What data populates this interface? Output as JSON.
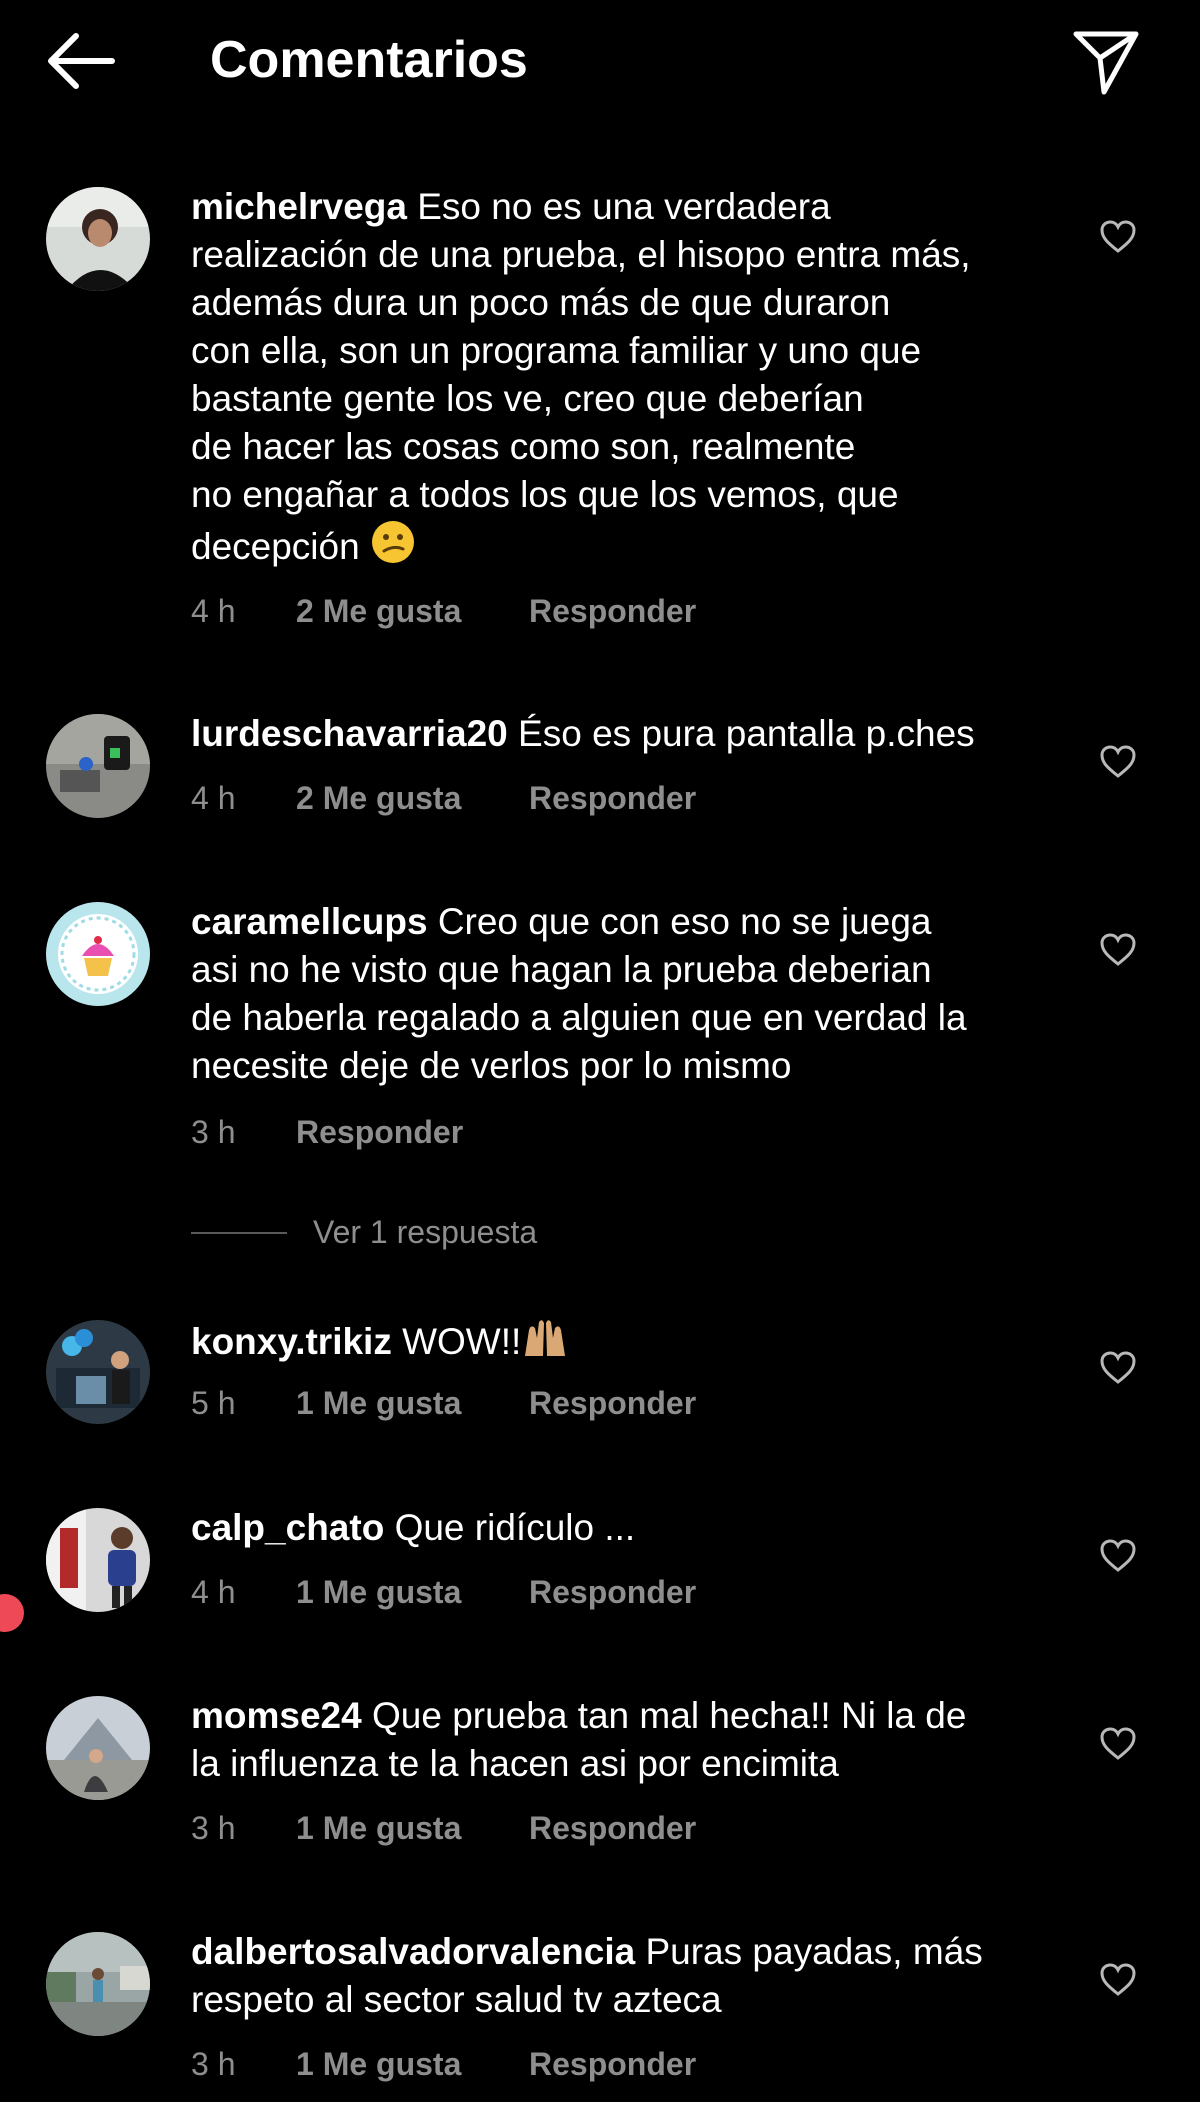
{
  "header": {
    "title": "Comentarios"
  },
  "comments": [
    {
      "username": "michelrvega",
      "text": "Eso no es una verdadera\nrealización de una prueba, el hisopo entra más,\nademás dura un poco más de que duraron\ncon ella, son un programa familiar y uno que\nbastante gente los ve, creo que deberían\nde hacer las cosas como son, realmente\nno engañar a todos los que los vemos, que\ndecepción",
      "time": "4 h",
      "likes": "2 Me gusta",
      "reply": "Responder"
    },
    {
      "username": "lurdeschavarria20",
      "text": "Éso es pura pantalla p.ches",
      "time": "4 h",
      "likes": "2 Me gusta",
      "reply": "Responder"
    },
    {
      "username": "caramellcups",
      "text": "Creo que con eso no se juega\nasi no he visto que hagan la prueba deberian\nde haberla regalado a alguien que en verdad la\nnecesite deje de verlos por lo mismo",
      "time": "3 h",
      "reply": "Responder",
      "replies_label": "Ver 1 respuesta"
    },
    {
      "username": "konxy.trikiz",
      "text": "WOW!!",
      "time": "5 h",
      "likes": "1 Me gusta",
      "reply": "Responder"
    },
    {
      "username": "calp_chato",
      "text": "Que  ridículo ...",
      "time": "4 h",
      "likes": "1 Me gusta",
      "reply": "Responder"
    },
    {
      "username": "momse24",
      "text": "Que prueba tan mal hecha!! Ni la de\nla influenza te la hacen asi por encimita",
      "time": "3 h",
      "likes": "1 Me gusta",
      "reply": "Responder"
    },
    {
      "username": "dalbertosalvadorvalencia",
      "text": "Puras payadas, más\nrespeto al sector salud tv azteca",
      "time": "3 h",
      "likes": "1 Me gusta",
      "reply": "Responder"
    }
  ],
  "colors": {
    "background": "#000000",
    "text": "#ffffff",
    "meta": "#8e8e8e",
    "notification": "#ed4956"
  },
  "icons": [
    "back-arrow-icon",
    "send-icon",
    "heart-icon",
    "confused-emoji-icon",
    "raising-hands-emoji-icon"
  ]
}
